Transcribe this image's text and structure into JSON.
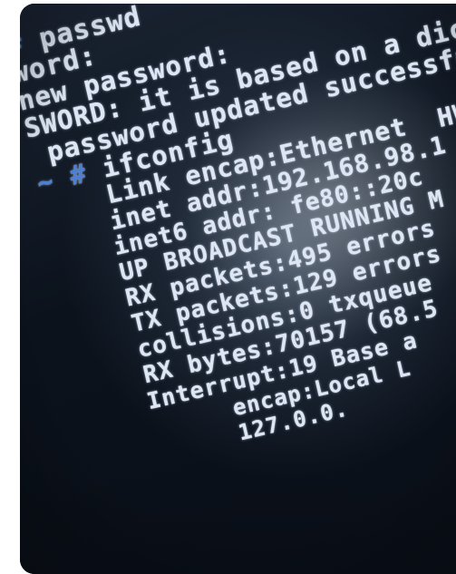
{
  "photo": {
    "description_style": "photographed terminal screen",
    "text_color": "#dde6f2",
    "prompt_color": "#4a7fd6",
    "background_color": "#0d1622"
  },
  "terminal": {
    "lines": [
      {
        "prefix": "",
        "hash": "#",
        "text": " passwd"
      },
      {
        "prefix": "",
        "hash": "",
        "text": "word:"
      },
      {
        "prefix": "",
        "hash": "",
        "text": "new password:"
      },
      {
        "prefix": "",
        "hash": "",
        "text": "SWORD: it is based on a dic"
      },
      {
        "prefix": "",
        "hash": "",
        "text": " password updated successfu"
      },
      {
        "prefix": "~ ",
        "hash": "#",
        "text": " ifconfig"
      },
      {
        "prefix": "",
        "hash": "",
        "text": "    Link encap:Ethernet  HW"
      },
      {
        "prefix": "",
        "hash": "",
        "text": "    inet addr:192.168.98.1"
      },
      {
        "prefix": "",
        "hash": "",
        "text": "    inet6 addr: fe80::20c"
      },
      {
        "prefix": "",
        "hash": "",
        "text": "    UP BROADCAST RUNNING M"
      },
      {
        "prefix": "",
        "hash": "",
        "text": "    RX packets:495 errors"
      },
      {
        "prefix": "",
        "hash": "",
        "text": "    TX packets:129 errors"
      },
      {
        "prefix": "",
        "hash": "",
        "text": "    collisions:0 txqueue"
      },
      {
        "prefix": "",
        "hash": "",
        "text": "    RX bytes:70157 (68.5"
      },
      {
        "prefix": "",
        "hash": "",
        "text": "    Interrupt:19 Base a"
      },
      {
        "prefix": "",
        "hash": "",
        "text": ""
      },
      {
        "prefix": "",
        "hash": "",
        "text": "          encap:Local L"
      },
      {
        "prefix": "",
        "hash": "",
        "text": "          127.0.0."
      }
    ]
  }
}
